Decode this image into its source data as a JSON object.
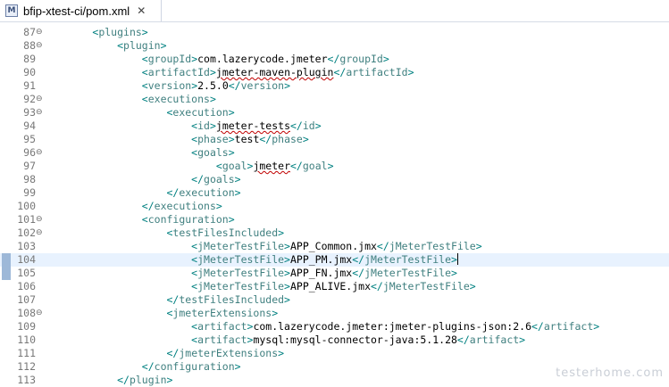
{
  "tab": {
    "title": "bfip-xtest-ci/pom.xml",
    "icon": "xml-file-icon",
    "close_glyph": "✕"
  },
  "editor": {
    "current_line": 104,
    "lines": [
      {
        "n": "87",
        "fold": true,
        "parts": [
          [
            "t",
            "        "
          ],
          [
            "b",
            "<"
          ],
          [
            "n",
            "plugins"
          ],
          [
            "b",
            ">"
          ]
        ]
      },
      {
        "n": "88",
        "fold": true,
        "parts": [
          [
            "t",
            "            "
          ],
          [
            "b",
            "<"
          ],
          [
            "n",
            "plugin"
          ],
          [
            "b",
            ">"
          ]
        ]
      },
      {
        "n": "89",
        "parts": [
          [
            "t",
            "                "
          ],
          [
            "b",
            "<"
          ],
          [
            "n",
            "groupId"
          ],
          [
            "b",
            ">"
          ],
          [
            "t",
            "com.lazerycode.jmeter"
          ],
          [
            "b",
            "</"
          ],
          [
            "n",
            "groupId"
          ],
          [
            "b",
            ">"
          ]
        ]
      },
      {
        "n": "90",
        "parts": [
          [
            "t",
            "                "
          ],
          [
            "b",
            "<"
          ],
          [
            "n",
            "artifactId"
          ],
          [
            "b",
            ">"
          ],
          [
            "tq",
            "jmeter-maven-plugin"
          ],
          [
            "b",
            "</"
          ],
          [
            "n",
            "artifactId"
          ],
          [
            "b",
            ">"
          ]
        ]
      },
      {
        "n": "91",
        "parts": [
          [
            "t",
            "                "
          ],
          [
            "b",
            "<"
          ],
          [
            "n",
            "version"
          ],
          [
            "b",
            ">"
          ],
          [
            "t",
            "2.5.0"
          ],
          [
            "b",
            "</"
          ],
          [
            "n",
            "version"
          ],
          [
            "b",
            ">"
          ]
        ]
      },
      {
        "n": "92",
        "fold": true,
        "parts": [
          [
            "t",
            "                "
          ],
          [
            "b",
            "<"
          ],
          [
            "n",
            "executions"
          ],
          [
            "b",
            ">"
          ]
        ]
      },
      {
        "n": "93",
        "fold": true,
        "parts": [
          [
            "t",
            "                    "
          ],
          [
            "b",
            "<"
          ],
          [
            "n",
            "execution"
          ],
          [
            "b",
            ">"
          ]
        ]
      },
      {
        "n": "94",
        "parts": [
          [
            "t",
            "                        "
          ],
          [
            "b",
            "<"
          ],
          [
            "n",
            "id"
          ],
          [
            "b",
            ">"
          ],
          [
            "tq",
            "jmeter-tests"
          ],
          [
            "b",
            "</"
          ],
          [
            "n",
            "id"
          ],
          [
            "b",
            ">"
          ]
        ]
      },
      {
        "n": "95",
        "parts": [
          [
            "t",
            "                        "
          ],
          [
            "b",
            "<"
          ],
          [
            "n",
            "phase"
          ],
          [
            "b",
            ">"
          ],
          [
            "t",
            "test"
          ],
          [
            "b",
            "</"
          ],
          [
            "n",
            "phase"
          ],
          [
            "b",
            ">"
          ]
        ]
      },
      {
        "n": "96",
        "fold": true,
        "parts": [
          [
            "t",
            "                        "
          ],
          [
            "b",
            "<"
          ],
          [
            "n",
            "goals"
          ],
          [
            "b",
            ">"
          ]
        ]
      },
      {
        "n": "97",
        "parts": [
          [
            "t",
            "                            "
          ],
          [
            "b",
            "<"
          ],
          [
            "n",
            "goal"
          ],
          [
            "b",
            ">"
          ],
          [
            "tq",
            "jmeter"
          ],
          [
            "b",
            "</"
          ],
          [
            "n",
            "goal"
          ],
          [
            "b",
            ">"
          ]
        ]
      },
      {
        "n": "98",
        "parts": [
          [
            "t",
            "                        "
          ],
          [
            "b",
            "</"
          ],
          [
            "n",
            "goals"
          ],
          [
            "b",
            ">"
          ]
        ]
      },
      {
        "n": "99",
        "parts": [
          [
            "t",
            "                    "
          ],
          [
            "b",
            "</"
          ],
          [
            "n",
            "execution"
          ],
          [
            "b",
            ">"
          ]
        ]
      },
      {
        "n": "100",
        "parts": [
          [
            "t",
            "                "
          ],
          [
            "b",
            "</"
          ],
          [
            "n",
            "executions"
          ],
          [
            "b",
            ">"
          ]
        ]
      },
      {
        "n": "101",
        "fold": true,
        "parts": [
          [
            "t",
            "                "
          ],
          [
            "b",
            "<"
          ],
          [
            "n",
            "configuration"
          ],
          [
            "b",
            ">"
          ]
        ]
      },
      {
        "n": "102",
        "fold": true,
        "parts": [
          [
            "t",
            "                    "
          ],
          [
            "b",
            "<"
          ],
          [
            "n",
            "testFilesIncluded"
          ],
          [
            "b",
            ">"
          ]
        ]
      },
      {
        "n": "103",
        "parts": [
          [
            "t",
            "                        "
          ],
          [
            "b",
            "<"
          ],
          [
            "n",
            "jMeterTestFile"
          ],
          [
            "b",
            ">"
          ],
          [
            "t",
            "APP_Common.jmx"
          ],
          [
            "b",
            "</"
          ],
          [
            "n",
            "jMeterTestFile"
          ],
          [
            "b",
            ">"
          ]
        ]
      },
      {
        "n": "104",
        "mark": true,
        "parts": [
          [
            "t",
            "                        "
          ],
          [
            "b",
            "<"
          ],
          [
            "n",
            "jMeterTestFile"
          ],
          [
            "b",
            ">"
          ],
          [
            "t",
            "APP_PM.jmx"
          ],
          [
            "b",
            "</"
          ],
          [
            "n",
            "jMeterTestFile"
          ],
          [
            "b",
            ">"
          ],
          [
            "caret",
            ""
          ]
        ]
      },
      {
        "n": "105",
        "mark": true,
        "parts": [
          [
            "t",
            "                        "
          ],
          [
            "b",
            "<"
          ],
          [
            "n",
            "jMeterTestFile"
          ],
          [
            "b",
            ">"
          ],
          [
            "t",
            "APP_FN.jmx"
          ],
          [
            "b",
            "</"
          ],
          [
            "n",
            "jMeterTestFile"
          ],
          [
            "b",
            ">"
          ]
        ]
      },
      {
        "n": "106",
        "parts": [
          [
            "t",
            "                        "
          ],
          [
            "b",
            "<"
          ],
          [
            "n",
            "jMeterTestFile"
          ],
          [
            "b",
            ">"
          ],
          [
            "t",
            "APP_ALIVE.jmx"
          ],
          [
            "b",
            "</"
          ],
          [
            "n",
            "jMeterTestFile"
          ],
          [
            "b",
            ">"
          ]
        ]
      },
      {
        "n": "107",
        "parts": [
          [
            "t",
            "                    "
          ],
          [
            "b",
            "</"
          ],
          [
            "n",
            "testFilesIncluded"
          ],
          [
            "b",
            ">"
          ]
        ]
      },
      {
        "n": "108",
        "fold": true,
        "parts": [
          [
            "t",
            "                    "
          ],
          [
            "b",
            "<"
          ],
          [
            "n",
            "jmeterExtensions"
          ],
          [
            "b",
            ">"
          ]
        ]
      },
      {
        "n": "109",
        "parts": [
          [
            "t",
            "                        "
          ],
          [
            "b",
            "<"
          ],
          [
            "n",
            "artifact"
          ],
          [
            "b",
            ">"
          ],
          [
            "t",
            "com.lazerycode.jmeter:jmeter-plugins-json:2.6"
          ],
          [
            "b",
            "</"
          ],
          [
            "n",
            "artifact"
          ],
          [
            "b",
            ">"
          ]
        ]
      },
      {
        "n": "110",
        "parts": [
          [
            "t",
            "                        "
          ],
          [
            "b",
            "<"
          ],
          [
            "n",
            "artifact"
          ],
          [
            "b",
            ">"
          ],
          [
            "t",
            "mysql:mysql-connector-java:5.1.28"
          ],
          [
            "b",
            "</"
          ],
          [
            "n",
            "artifact"
          ],
          [
            "b",
            ">"
          ]
        ]
      },
      {
        "n": "111",
        "parts": [
          [
            "t",
            "                    "
          ],
          [
            "b",
            "</"
          ],
          [
            "n",
            "jmeterExtensions"
          ],
          [
            "b",
            ">"
          ]
        ]
      },
      {
        "n": "112",
        "parts": [
          [
            "t",
            "                "
          ],
          [
            "b",
            "</"
          ],
          [
            "n",
            "configuration"
          ],
          [
            "b",
            ">"
          ]
        ]
      },
      {
        "n": "113",
        "parts": [
          [
            "t",
            "            "
          ],
          [
            "b",
            "</"
          ],
          [
            "n",
            "plugin"
          ],
          [
            "b",
            ">"
          ]
        ]
      }
    ]
  },
  "watermark": "testerhome.com",
  "colors": {
    "bracket": "#008080",
    "tagname": "#3f7f7f",
    "text": "#000000",
    "current_line_bg": "#e8f2fe",
    "line_number": "#787878"
  }
}
